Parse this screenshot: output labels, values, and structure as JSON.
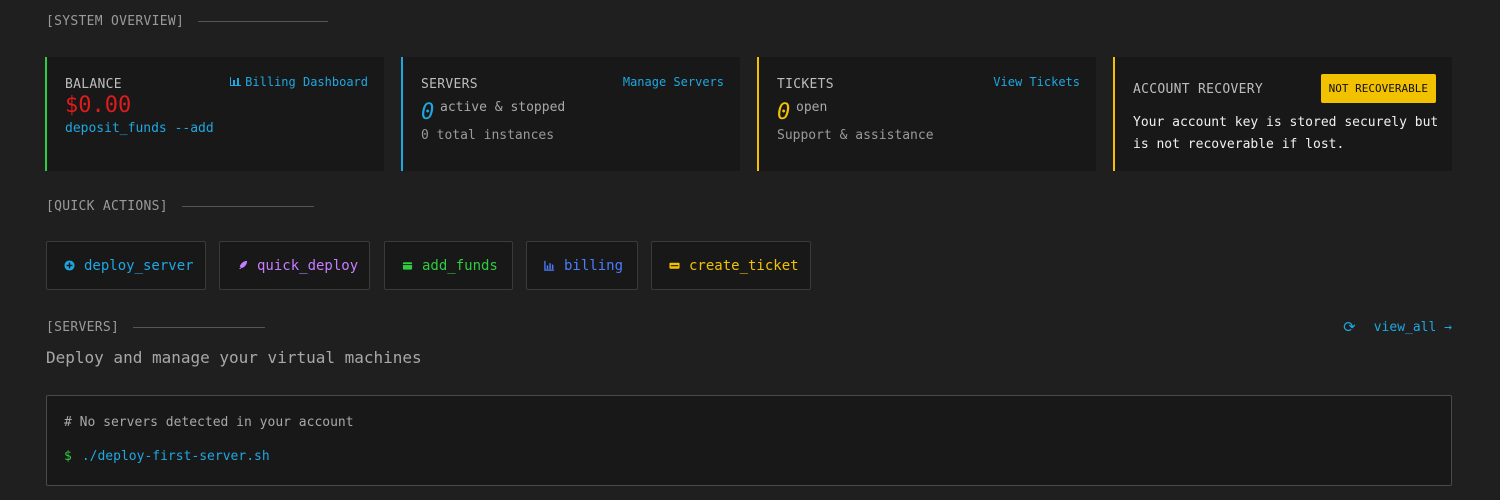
{
  "sections": {
    "system_overview": "[SYSTEM OVERVIEW]",
    "quick_actions": "[QUICK ACTIONS]",
    "servers": "[SERVERS]"
  },
  "cards": {
    "balance": {
      "label": "BALANCE",
      "link": "Billing Dashboard",
      "value": "$0.00",
      "command": "deposit_funds --add",
      "accent": "#2ecc40"
    },
    "servers": {
      "label": "SERVERS",
      "link": "Manage Servers",
      "count": "0",
      "count_label": "active & stopped",
      "sub": "0 total instances",
      "accent": "#1ea7e1"
    },
    "tickets": {
      "label": "TICKETS",
      "link": "View Tickets",
      "count": "0",
      "count_label": "open",
      "sub": "Support & assistance",
      "accent": "#f2c200"
    },
    "recovery": {
      "label": "ACCOUNT RECOVERY",
      "badge": "NOT RECOVERABLE",
      "text": "Your account key is stored securely but is not recoverable if lost.",
      "accent": "#f2c200"
    }
  },
  "actions": [
    {
      "label": "deploy_server",
      "icon": "plus-circle-icon",
      "color": "#1ea7e1"
    },
    {
      "label": "quick_deploy",
      "icon": "rocket-icon",
      "color": "#c77dff"
    },
    {
      "label": "add_funds",
      "icon": "wallet-icon",
      "color": "#2ecc40"
    },
    {
      "label": "billing",
      "icon": "chart-icon",
      "color": "#4a7dff"
    },
    {
      "label": "create_ticket",
      "icon": "ticket-icon",
      "color": "#f2c200"
    }
  ],
  "servers_section": {
    "description": "Deploy and manage your virtual machines",
    "view_all": "view_all →",
    "refresh_icon": "refresh-icon",
    "terminal_comment": "# No servers detected in your account",
    "terminal_prompt": "$",
    "terminal_command": "./deploy-first-server.sh"
  }
}
